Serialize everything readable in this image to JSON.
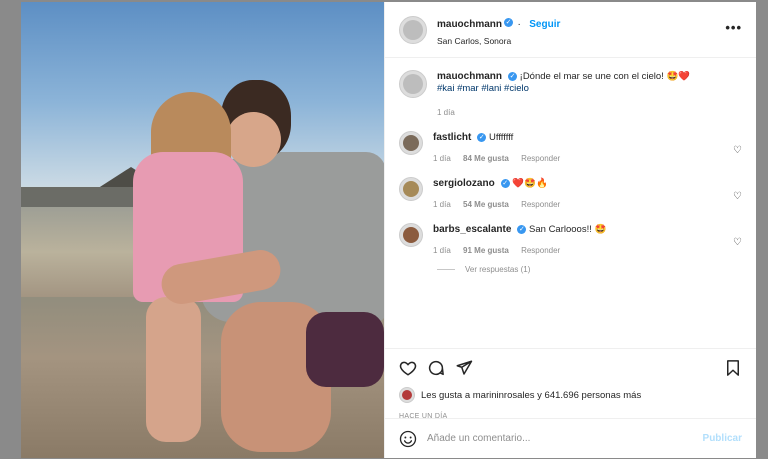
{
  "post": {
    "username": "mauochmann",
    "follow_label": "Seguir",
    "location": "San Carlos, Sonora",
    "more_label": "•••"
  },
  "caption": {
    "username": "mauochmann",
    "text": "¡Dónde el mar se une con el cielo! 🤩❤️",
    "hashtags": "#kai #mar #lani #cielo",
    "time": "1 día"
  },
  "comments": [
    {
      "username": "fastlicht",
      "text": "Ufffffff",
      "time": "1 día",
      "likes": "84 Me gusta",
      "reply": "Responder"
    },
    {
      "username": "sergiolozano",
      "text": "❤️🤩🔥",
      "time": "1 día",
      "likes": "54 Me gusta",
      "reply": "Responder"
    },
    {
      "username": "barbs_escalante",
      "text": "San Carlooos!! 🤩",
      "time": "1 día",
      "likes": "91 Me gusta",
      "reply": "Responder"
    }
  ],
  "view_replies": "Ver respuestas (1)",
  "likes_text": "Les gusta a marininrosales y 641.696 personas más",
  "timestamp": "HACE UN DÍA",
  "add_comment": {
    "placeholder": "Añade un comentario...",
    "publish": "Publicar"
  },
  "colors": {
    "link": "#0095f6",
    "publish_disabled": "#b2dffc",
    "verified": "#3897f0"
  },
  "icons": [
    "heart-icon",
    "comment-icon",
    "share-icon",
    "bookmark-icon",
    "emoji-icon",
    "more-icon",
    "verified-icon"
  ]
}
